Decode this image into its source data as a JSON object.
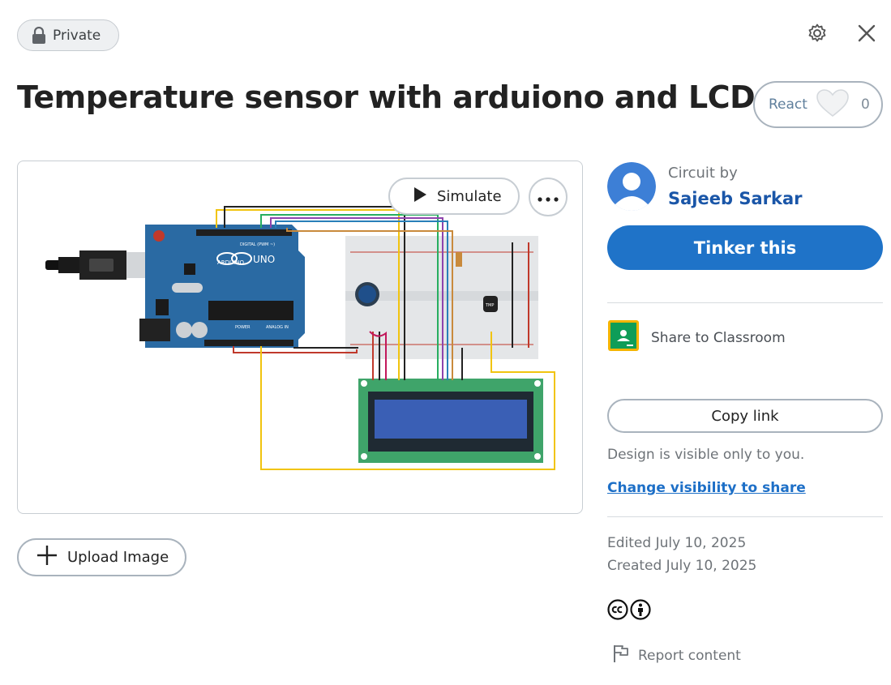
{
  "privacy": {
    "label": "Private"
  },
  "header": {
    "settings_icon": "gear-icon",
    "close_icon": "close-icon"
  },
  "design": {
    "title": "Temperature sensor with arduiono and LCD"
  },
  "react": {
    "label": "React",
    "count": "0"
  },
  "canvas": {
    "simulate_label": "Simulate",
    "board_labels": {
      "uno": "UNO",
      "arduino": "ARDUINO",
      "digital": "DIGITAL (PWM ~)",
      "power": "POWER",
      "analog": "ANALOG IN",
      "sensor": "TMP"
    }
  },
  "upload": {
    "label": "Upload Image"
  },
  "author": {
    "circuit_by": "Circuit by",
    "name": "Sajeeb Sarkar"
  },
  "actions": {
    "tinker_label": "Tinker this",
    "share_classroom_label": "Share to Classroom",
    "copy_link_label": "Copy link",
    "visibility_note": "Design is visible only to you.",
    "change_visibility_label": "Change visibility to share"
  },
  "meta": {
    "edited": "Edited July 10, 2025",
    "created": "Created July 10, 2025"
  },
  "report": {
    "label": "Report content"
  },
  "colors": {
    "accent": "#1f73c8",
    "link": "#1a56a8",
    "arduino": "#2a6aa3",
    "lcd_board": "#3fa46a",
    "lcd_screen": "#3a5fb5"
  }
}
